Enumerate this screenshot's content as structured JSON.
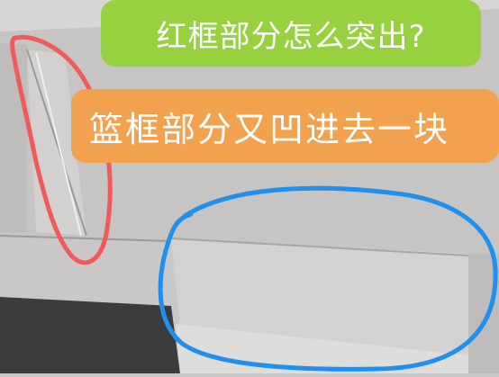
{
  "captions": {
    "top": "红框部分怎么突出?",
    "middle": "篮框部分又凹进去一块"
  },
  "colors": {
    "caption_top_bg": "#97d13f",
    "caption_middle_bg": "#f2a24f",
    "red_circle": "#f25a5a",
    "blue_circle": "#1e90f0"
  }
}
